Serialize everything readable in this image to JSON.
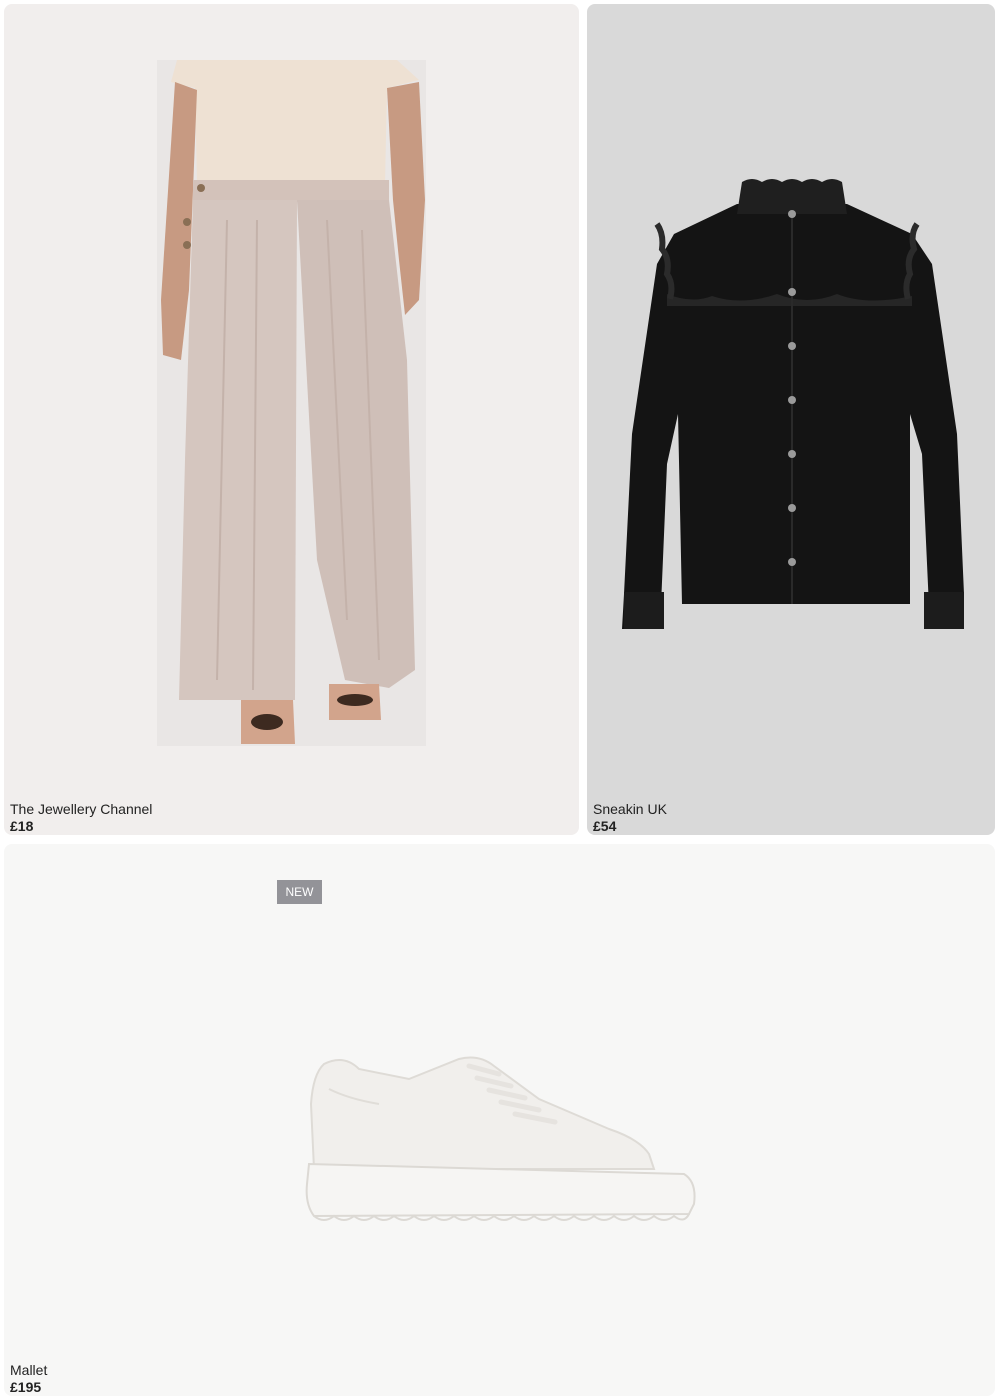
{
  "products": [
    {
      "brand": "The Jewellery Channel",
      "price": "£18",
      "image": "wide-leg-linen-trousers"
    },
    {
      "brand": "Sneakin UK",
      "price": "£54",
      "image": "black-ruffle-denim-shirt"
    },
    {
      "brand": "Mallet",
      "price": "£195",
      "image": "white-leather-sneaker",
      "badge": "NEW"
    }
  ]
}
